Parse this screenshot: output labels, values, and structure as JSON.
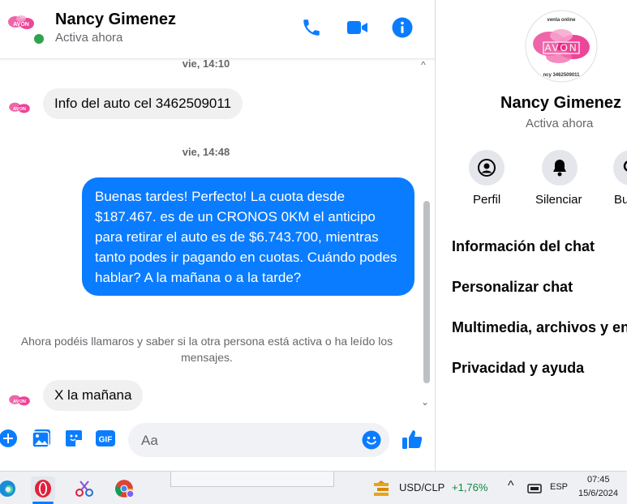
{
  "header": {
    "name": "Nancy Gimenez",
    "status": "Activa ahora",
    "avatar_text": "AVON"
  },
  "messages": {
    "time1": "vie, 14:10",
    "msg1": "Info del auto cel 3462509011",
    "time2": "vie, 14:48",
    "msg2": "Buenas tardes! Perfecto! La cuota desde $187.467. es de un CRONOS 0KM el anticipo para retirar el auto es de $6.743.700, mientras tanto podes ir pagando en cuotas. Cuándo podes hablar? A la mañana o a la tarde?",
    "system_note": "Ahora podéis llamaros y saber si la otra persona está activa o ha leído los mensajes.",
    "msg3": "X la mañana"
  },
  "composer": {
    "placeholder": "Aa"
  },
  "side_panel": {
    "name": "Nancy Gimenez",
    "status": "Activa ahora",
    "avatar_top_text": "venta online",
    "avatar_text": "AVON",
    "avatar_bottom_text": "ncy 3462509011",
    "actions": [
      {
        "label": "Perfil",
        "icon": "user-circle-icon"
      },
      {
        "label": "Silenciar",
        "icon": "bell-icon"
      },
      {
        "label": "Bu",
        "icon": "search-icon"
      }
    ],
    "items": [
      "Información del chat",
      "Personalizar chat",
      "Multimedia, archivos y en",
      "Privacidad y ayuda"
    ]
  },
  "taskbar": {
    "ticker": "USD/CLP",
    "change": "+1,76%",
    "lang": "ESP",
    "time": "07:45",
    "date": "15/6/2024"
  },
  "colors": {
    "accent": "#0a7cff",
    "online": "#31a24c",
    "ticker_up": "#0f8a3a",
    "avon_pink": "#e8177e"
  }
}
